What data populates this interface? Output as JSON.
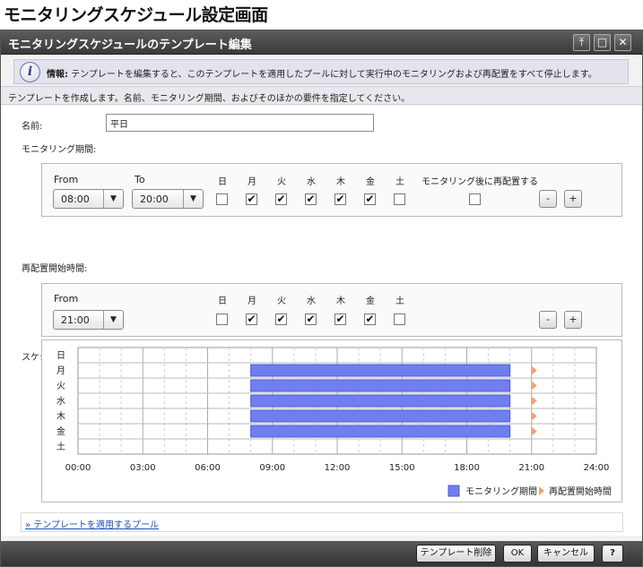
{
  "page": {
    "title": "モニタリングスケジュール設定画面"
  },
  "dialog": {
    "title": "モニタリングスケジュールのテンプレート編集"
  },
  "info": {
    "label": "情報:",
    "text": "テンプレートを編集すると、このテンプレートを適用したプールに対して実行中のモニタリングおよび再配置をすべて停止します。"
  },
  "description": "テンプレートを作成します。名前、モニタリング期間、およびそのほかの要件を指定してください。",
  "form": {
    "name_label": "名前:",
    "name_value": "平日",
    "monitoring_label": "モニタリング期間:",
    "relocation_label": "再配置開始時間:",
    "summary_label": "スケジュール概要:"
  },
  "monitoring": {
    "from_label": "From",
    "to_label": "To",
    "from_value": "08:00",
    "to_value": "20:00",
    "days": [
      "日",
      "月",
      "火",
      "水",
      "木",
      "金",
      "土"
    ],
    "days_checked": [
      false,
      true,
      true,
      true,
      true,
      true,
      false
    ],
    "relocate_after_label": "モニタリング後に再配置する",
    "relocate_after_checked": false,
    "minus": "-",
    "plus": "+"
  },
  "relocation": {
    "from_label": "From",
    "from_value": "21:00",
    "days": [
      "日",
      "月",
      "火",
      "水",
      "木",
      "金",
      "土"
    ],
    "days_checked": [
      false,
      true,
      true,
      true,
      true,
      true,
      false
    ],
    "minus": "-",
    "plus": "+"
  },
  "chart_data": {
    "type": "gantt",
    "rows": [
      "日",
      "月",
      "火",
      "水",
      "木",
      "金",
      "土"
    ],
    "x_ticks": [
      "00:00",
      "03:00",
      "06:00",
      "09:00",
      "12:00",
      "15:00",
      "18:00",
      "21:00",
      "24:00"
    ],
    "xlim": [
      0,
      24
    ],
    "monitoring": [
      {
        "row": "月",
        "start": 8,
        "end": 20
      },
      {
        "row": "火",
        "start": 8,
        "end": 20
      },
      {
        "row": "水",
        "start": 8,
        "end": 20
      },
      {
        "row": "木",
        "start": 8,
        "end": 20
      },
      {
        "row": "金",
        "start": 8,
        "end": 20
      }
    ],
    "relocation_start": [
      {
        "row": "月",
        "time": 21
      },
      {
        "row": "火",
        "time": 21
      },
      {
        "row": "水",
        "time": 21
      },
      {
        "row": "木",
        "time": 21
      },
      {
        "row": "金",
        "time": 21
      }
    ],
    "legend": {
      "monitoring": "モニタリング期間",
      "relocation": "再配置開始時間"
    },
    "colors": {
      "monitoring": "#6f7ff0",
      "relocation": "#f0a070"
    }
  },
  "link": {
    "label": "テンプレートを適用するプール"
  },
  "footer": {
    "delete": "テンプレート削除",
    "ok": "OK",
    "cancel": "キャンセル",
    "help": "?"
  }
}
